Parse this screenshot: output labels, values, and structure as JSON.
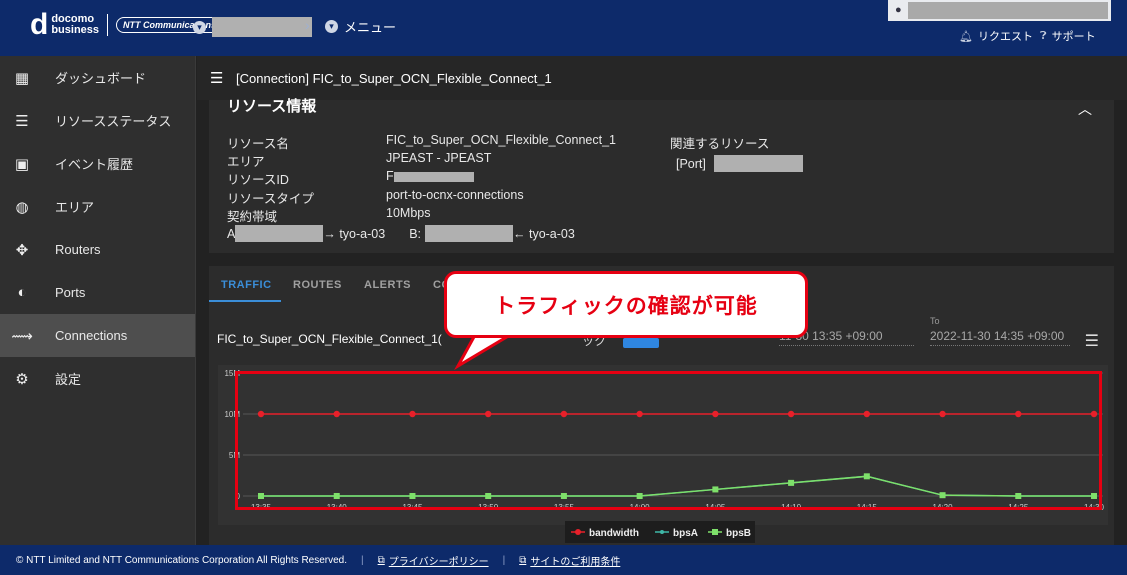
{
  "header": {
    "logo_line1": "docomo",
    "logo_line2": "business",
    "ntt_logo": "NTT Communications",
    "breadcrumb_menu": "メニュー",
    "request_label": "リクエスト",
    "support_label": "サポート"
  },
  "sidebar": {
    "items": [
      {
        "label": "ダッシュボード",
        "icon": "grid-icon"
      },
      {
        "label": "リソースステータス",
        "icon": "status-list-icon"
      },
      {
        "label": "イベント履歴",
        "icon": "calendar-check-icon"
      },
      {
        "label": "エリア",
        "icon": "globe-icon"
      },
      {
        "label": "Routers",
        "icon": "router-icon"
      },
      {
        "label": "Ports",
        "icon": "ports-icon"
      },
      {
        "label": "Connections",
        "icon": "connection-icon"
      },
      {
        "label": "設定",
        "icon": "gear-icon"
      }
    ],
    "active_index": 6
  },
  "topbar": {
    "title": "[Connection] FIC_to_Super_OCN_Flexible_Connect_1"
  },
  "resource": {
    "section_title": "リソース情報",
    "labels": {
      "name": "リソース名",
      "area": "エリア",
      "id": "リソースID",
      "type": "リソースタイプ",
      "bandwidth": "契約帯域"
    },
    "values": {
      "name": "FIC_to_Super_OCN_Flexible_Connect_1",
      "area": "JPEAST - JPEAST",
      "id_prefix": "F",
      "type": "port-to-ocnx-connections",
      "bandwidth": "10Mbps"
    },
    "endpoint_a_prefix": "A",
    "endpoint_a_suffix": "→ tyo-a-03",
    "endpoint_b_prefix": "B:",
    "endpoint_b_suffix": "← tyo-a-03",
    "related_title": "関連するリソース",
    "related_port_label": "[Port]"
  },
  "traffic": {
    "tabs": [
      "TRAFFIC",
      "ROUTES",
      "ALERTS",
      "CO"
    ],
    "active_tab": 0,
    "chart_title": "FIC_to_Super_OCN_Flexible_Connect_1(",
    "chart_title_tail": "ック",
    "from_value": "11-30 13:35 +09:00",
    "to_label": "To",
    "to_value": "2022-11-30 14:35 +09:00"
  },
  "callout": {
    "text": "トラフィックの確認が可能"
  },
  "footer": {
    "copyright": "© NTT Limited and NTT Communications Corporation All Rights Reserved.",
    "privacy": "プライバシーポリシー",
    "terms": "サイトのご利用条件"
  },
  "colors": {
    "header_bg": "#0d2a6a",
    "accent": "#3b8ed8",
    "highlight": "#e60012",
    "bandwidth": "#e8202a",
    "bpsA": "#3fb8a8",
    "bpsB": "#7ee06a"
  },
  "chart_data": {
    "type": "line",
    "x": [
      "13:35",
      "13:40",
      "13:45",
      "13:50",
      "13:55",
      "14:00",
      "14:05",
      "14:10",
      "14:15",
      "14:20",
      "14:25",
      "14:30"
    ],
    "y_ticks": [
      "0",
      "5M",
      "10M",
      "15M"
    ],
    "ylim": [
      0,
      15
    ],
    "series": [
      {
        "name": "bandwidth",
        "values": [
          10,
          10,
          10,
          10,
          10,
          10,
          10,
          10,
          10,
          10,
          10,
          10
        ]
      },
      {
        "name": "bpsA",
        "values": [
          0,
          0,
          0,
          0,
          0,
          0,
          0.8,
          1.6,
          2.4,
          0.1,
          0,
          0
        ]
      },
      {
        "name": "bpsB",
        "values": [
          0,
          0,
          0,
          0,
          0,
          0,
          0.8,
          1.6,
          2.4,
          0.1,
          0,
          0
        ]
      }
    ],
    "legend": [
      "bandwidth",
      "bpsA",
      "bpsB"
    ],
    "legend_position": "bottom-center",
    "grid": true
  }
}
